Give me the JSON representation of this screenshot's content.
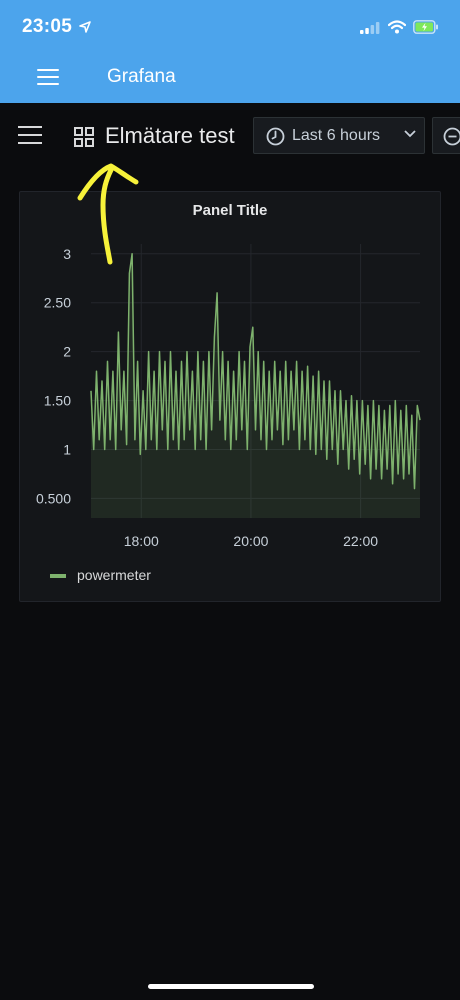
{
  "status_bar": {
    "time": "23:05"
  },
  "app_header": {
    "title": "Grafana"
  },
  "navbar": {
    "dashboard_title": "Elmätare test",
    "time_range": "Last 6 hours",
    "icons": [
      "menu-icon",
      "dashboard-grid-icon",
      "clock-icon",
      "chevron-down-icon",
      "zoom-out-icon"
    ]
  },
  "panel": {
    "title": "Panel Title",
    "legend": [
      "powermeter"
    ]
  },
  "chart_data": {
    "type": "area",
    "title": "Panel Title",
    "xlabel": "",
    "ylabel": "",
    "x_ticks": [
      "18:00",
      "20:00",
      "22:00"
    ],
    "y_ticks": [
      "0.500",
      "1",
      "1.50",
      "2",
      "2.50",
      "3"
    ],
    "ylim": [
      0.3,
      3.1
    ],
    "xlim": [
      "17:05",
      "23:05"
    ],
    "grid": true,
    "legend_position": "bottom-left",
    "series": [
      {
        "name": "powermeter",
        "color": "#7eb26d",
        "x": [
          "17:05",
          "17:08",
          "17:11",
          "17:14",
          "17:17",
          "17:20",
          "17:23",
          "17:26",
          "17:29",
          "17:32",
          "17:35",
          "17:38",
          "17:41",
          "17:44",
          "17:47",
          "17:50",
          "17:53",
          "17:56",
          "17:59",
          "18:02",
          "18:05",
          "18:08",
          "18:11",
          "18:14",
          "18:17",
          "18:20",
          "18:23",
          "18:26",
          "18:29",
          "18:32",
          "18:35",
          "18:38",
          "18:41",
          "18:44",
          "18:47",
          "18:50",
          "18:53",
          "18:56",
          "18:59",
          "19:02",
          "19:05",
          "19:08",
          "19:11",
          "19:14",
          "19:17",
          "19:20",
          "19:23",
          "19:26",
          "19:29",
          "19:32",
          "19:35",
          "19:38",
          "19:41",
          "19:44",
          "19:47",
          "19:50",
          "19:53",
          "19:56",
          "19:59",
          "20:02",
          "20:05",
          "20:08",
          "20:11",
          "20:14",
          "20:17",
          "20:20",
          "20:23",
          "20:26",
          "20:29",
          "20:32",
          "20:35",
          "20:38",
          "20:41",
          "20:44",
          "20:47",
          "20:50",
          "20:53",
          "20:56",
          "20:59",
          "21:02",
          "21:05",
          "21:08",
          "21:11",
          "21:14",
          "21:17",
          "21:20",
          "21:23",
          "21:26",
          "21:29",
          "21:32",
          "21:35",
          "21:38",
          "21:41",
          "21:44",
          "21:47",
          "21:50",
          "21:53",
          "21:56",
          "21:59",
          "22:02",
          "22:05",
          "22:08",
          "22:11",
          "22:14",
          "22:17",
          "22:20",
          "22:23",
          "22:26",
          "22:29",
          "22:32",
          "22:35",
          "22:38",
          "22:41",
          "22:44",
          "22:47",
          "22:50",
          "22:53",
          "22:56",
          "22:59",
          "23:02",
          "23:05"
        ],
        "values": [
          1.6,
          1.0,
          1.8,
          1.1,
          1.7,
          1.0,
          1.9,
          1.1,
          1.8,
          1.0,
          2.2,
          1.2,
          1.8,
          1.05,
          2.8,
          3.0,
          1.1,
          1.9,
          0.95,
          1.6,
          1.0,
          2.0,
          1.1,
          1.8,
          1.0,
          2.0,
          1.2,
          1.9,
          1.0,
          2.0,
          1.1,
          1.8,
          1.0,
          1.9,
          1.1,
          2.0,
          1.2,
          1.8,
          1.0,
          2.0,
          1.1,
          1.9,
          1.0,
          2.0,
          1.2,
          2.15,
          2.6,
          1.3,
          2.0,
          1.1,
          1.9,
          1.0,
          1.8,
          1.1,
          2.0,
          1.2,
          1.9,
          1.0,
          2.05,
          2.25,
          1.2,
          2.0,
          1.1,
          1.9,
          1.0,
          1.8,
          1.1,
          1.9,
          1.2,
          1.8,
          1.05,
          1.9,
          1.1,
          1.8,
          1.2,
          1.9,
          1.0,
          1.8,
          1.1,
          1.85,
          1.0,
          1.75,
          0.95,
          1.8,
          1.0,
          1.7,
          0.9,
          1.7,
          1.0,
          1.6,
          0.85,
          1.6,
          1.0,
          1.5,
          0.8,
          1.55,
          0.9,
          1.5,
          0.75,
          1.5,
          0.85,
          1.45,
          0.7,
          1.5,
          0.8,
          1.45,
          0.7,
          1.4,
          0.8,
          1.45,
          0.65,
          1.5,
          0.75,
          1.4,
          0.7,
          1.45,
          0.75,
          1.35,
          0.6,
          1.45,
          1.3
        ]
      }
    ]
  }
}
